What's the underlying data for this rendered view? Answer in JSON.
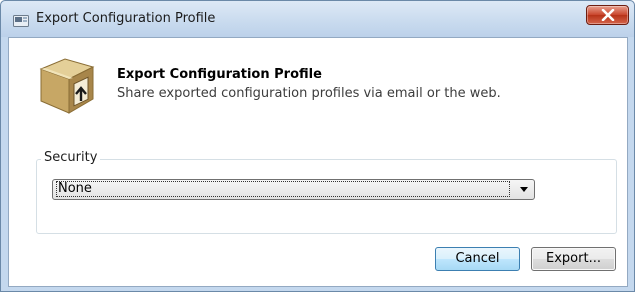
{
  "window": {
    "title": "Export Configuration Profile",
    "close_icon": "close-x-icon"
  },
  "header": {
    "icon": "export-box-icon",
    "title": "Export Configuration Profile",
    "subtitle": "Share exported configuration profiles via email or the web."
  },
  "security": {
    "group_label": "Security",
    "selected_value": "None"
  },
  "buttons": {
    "cancel_label": "Cancel",
    "export_label": "Export..."
  },
  "colors": {
    "title_bar": "#c8daee",
    "close_button": "#c9442b",
    "focused_button_border": "#3c7fb1"
  }
}
